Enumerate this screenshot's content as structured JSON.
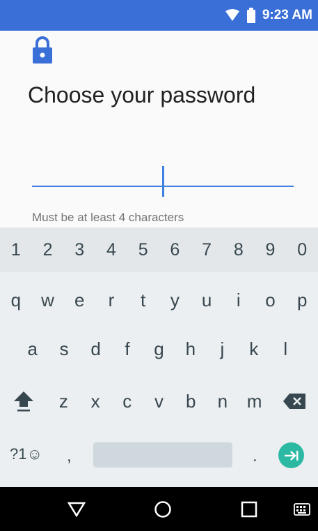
{
  "status_bar": {
    "time": "9:23 AM",
    "icons": [
      "wifi-icon",
      "battery-icon"
    ]
  },
  "screen": {
    "title": "Choose your password",
    "hint": "Must be at least 4 characters",
    "password_value": ""
  },
  "keyboard": {
    "number_row": [
      "1",
      "2",
      "3",
      "4",
      "5",
      "6",
      "7",
      "8",
      "9",
      "0"
    ],
    "row1": [
      "q",
      "w",
      "e",
      "r",
      "t",
      "y",
      "u",
      "i",
      "o",
      "p"
    ],
    "row2": [
      "a",
      "s",
      "d",
      "f",
      "g",
      "h",
      "j",
      "k",
      "l"
    ],
    "row3": [
      "z",
      "x",
      "c",
      "v",
      "b",
      "n",
      "m"
    ],
    "symbols_label": "?1☺",
    "comma": ",",
    "period": "."
  },
  "colors": {
    "accent": "#3f80e0",
    "enter": "#2bb9a4",
    "status_bar": "#3b6fd8"
  },
  "nav_bar": {
    "icons": [
      "back-icon",
      "home-icon",
      "recents-icon",
      "keyboard-switch-icon"
    ]
  }
}
